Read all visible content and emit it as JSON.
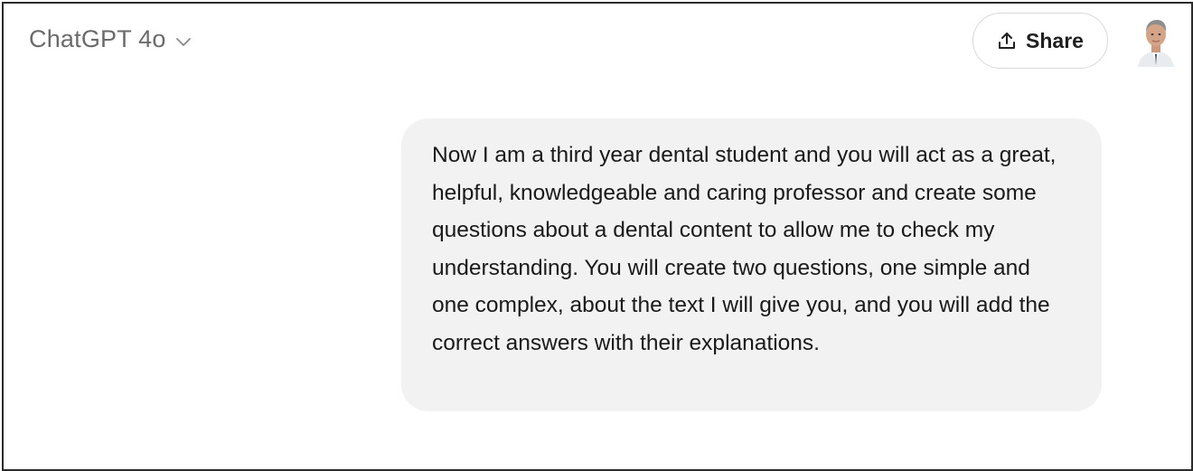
{
  "header": {
    "model_name": "ChatGPT 4o",
    "model_dropdown_icon": "chevron-down-icon",
    "share_label": "Share",
    "share_icon": "upload-icon",
    "avatar_icon": "user-avatar"
  },
  "conversation": {
    "messages": [
      {
        "role": "user",
        "text": "Now I am a third year dental student and you will act as a great, helpful, knowledgeable and caring professor and create some questions about a dental content to allow me to check my understanding. You will create two questions, one simple and one complex, about the text I will give you, and you will add the correct answers with their explanations."
      }
    ]
  },
  "colors": {
    "bubble_background": "#f2f2f2",
    "model_name_text": "#6b6b6b",
    "share_border": "#d9d9d9",
    "frame_border": "#2b2b2b"
  }
}
